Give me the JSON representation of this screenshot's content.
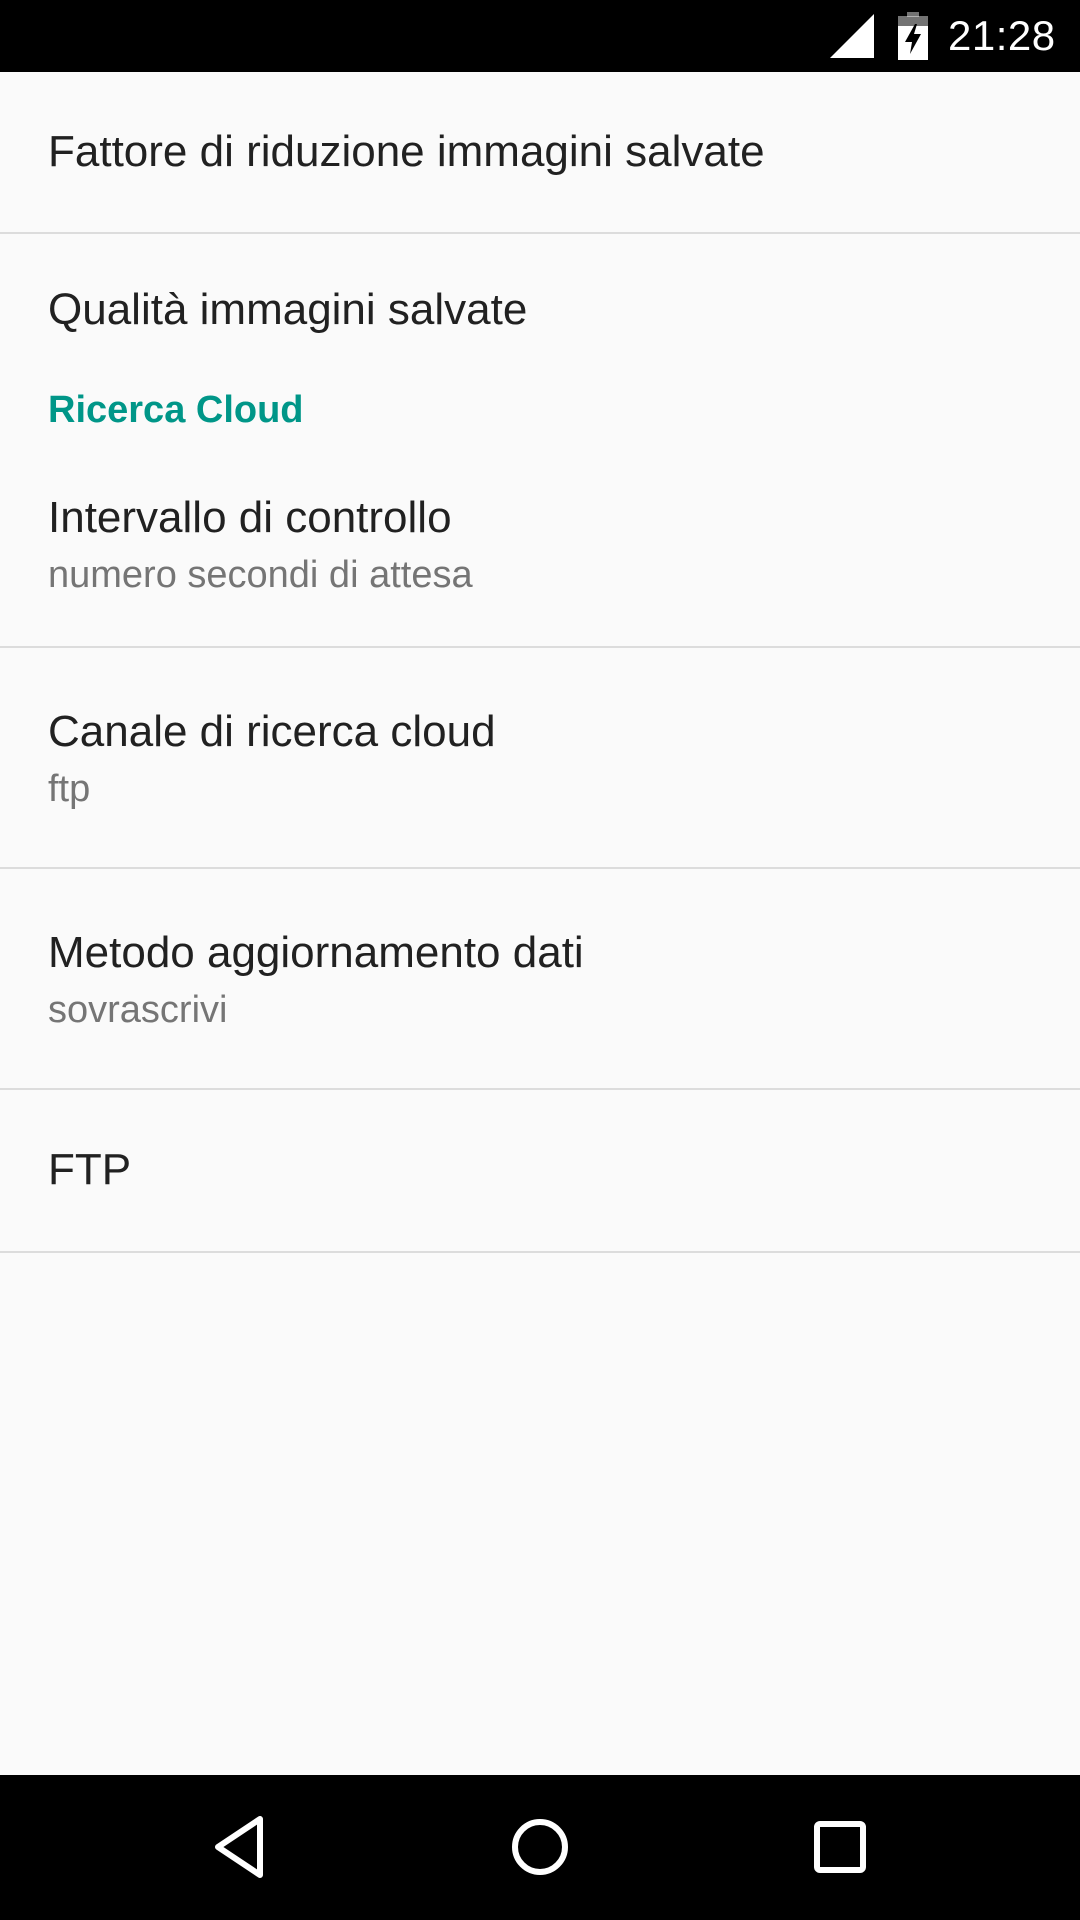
{
  "status_bar": {
    "time": "21:28",
    "icons": [
      "cell-signal-icon",
      "battery-charging-icon"
    ]
  },
  "preferences": {
    "pref_scale_factor": {
      "title": "Fattore di riduzione immagini salvate"
    },
    "pref_quality": {
      "title": "Qualità immagini salvate"
    },
    "category_cloud": {
      "title": "Ricerca Cloud"
    },
    "pref_interval": {
      "title": "Intervallo di controllo",
      "summary": "numero secondi di attesa"
    },
    "pref_channel": {
      "title": "Canale di ricerca cloud",
      "summary": "ftp"
    },
    "pref_update_method": {
      "title": "Metodo aggiornamento dati",
      "summary": "sovrascrivi"
    },
    "pref_ftp": {
      "title": "FTP"
    }
  },
  "nav_bar": {
    "buttons": [
      "back-icon",
      "home-icon",
      "recents-icon"
    ]
  },
  "colors": {
    "accent": "#009688",
    "background": "#fafafa",
    "title_text": "#212121",
    "summary_text": "#757575",
    "divider": "#dcdcdc",
    "system_bars": "#000000"
  }
}
